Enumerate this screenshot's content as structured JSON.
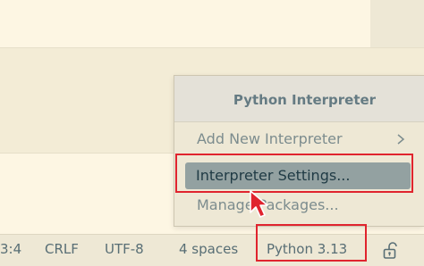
{
  "status_bar": {
    "cursor_position": "3:4",
    "line_ending": "CRLF",
    "encoding": "UTF-8",
    "indentation": "4 spaces",
    "interpreter": "Python 3.13",
    "lock_icon": "lock-open-icon"
  },
  "interpreter_popup": {
    "title": "Python Interpreter",
    "items": [
      {
        "label": "Add New Interpreter",
        "has_submenu": true
      },
      {
        "label": "Interpreter Settings...",
        "selected": true
      },
      {
        "label": "Manage Packages..."
      }
    ]
  },
  "highlight_color": "#e0242e",
  "pointer": "mouse-pointer-icon"
}
